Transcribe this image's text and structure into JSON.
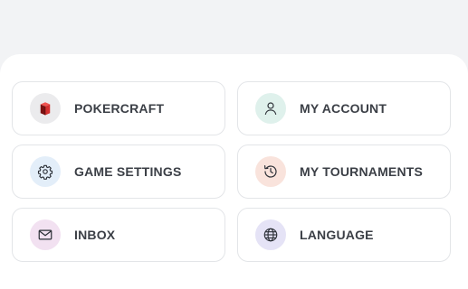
{
  "menu": {
    "items": [
      {
        "label": "POKERCRAFT",
        "icon": "pokercraft-cube-icon",
        "icon_bg": "#ebebed",
        "icon_color": "#c62828"
      },
      {
        "label": "MY ACCOUNT",
        "icon": "user-icon",
        "icon_bg": "#dff1ec",
        "icon_color": "#2b2f36"
      },
      {
        "label": "GAME SETTINGS",
        "icon": "gear-icon",
        "icon_bg": "#e3eef9",
        "icon_color": "#2b2f36"
      },
      {
        "label": "MY TOURNAMENTS",
        "icon": "history-clock-icon",
        "icon_bg": "#f9e3dc",
        "icon_color": "#2b2f36"
      },
      {
        "label": "INBOX",
        "icon": "envelope-icon",
        "icon_bg": "#f2e1f1",
        "icon_color": "#2b2f36"
      },
      {
        "label": "LANGUAGE",
        "icon": "globe-icon",
        "icon_bg": "#e5e3f6",
        "icon_color": "#2b2f36"
      }
    ]
  }
}
